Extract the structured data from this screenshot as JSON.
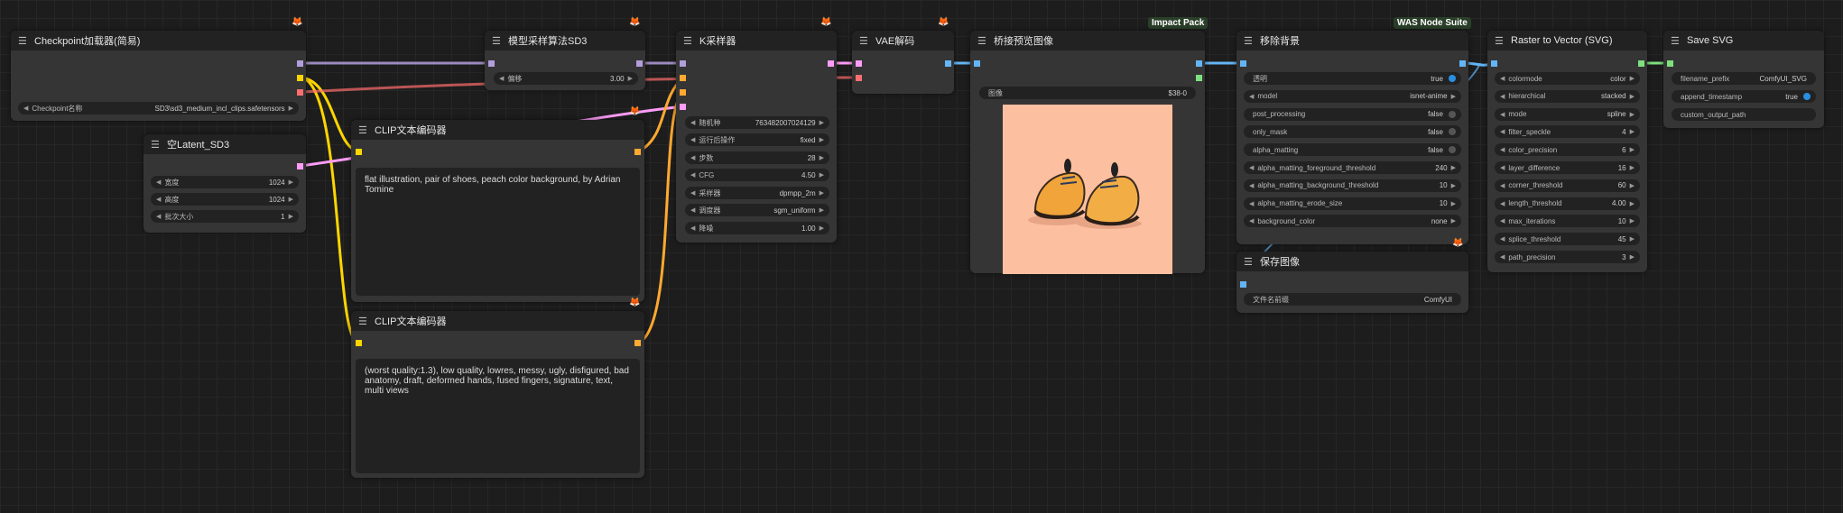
{
  "nodes": {
    "checkpoint": {
      "title": "Checkpoint加载器(简易)",
      "ckpt_label": "Checkpoint名称",
      "ckpt_value": "SD3\\sd3_medium_incl_clips.safetensors"
    },
    "latent": {
      "title": "空Latent_SD3",
      "width_label": "宽度",
      "width_value": "1024",
      "height_label": "高度",
      "height_value": "1024",
      "batch_label": "批次大小",
      "batch_value": "1"
    },
    "sampling": {
      "title": "模型采样算法SD3",
      "shift_label": "偏移",
      "shift_value": "3.00"
    },
    "clip_pos": {
      "title": "CLIP文本编码器",
      "text": "flat illustration, pair of shoes, peach color background, by Adrian Tomine"
    },
    "clip_neg": {
      "title": "CLIP文本编码器",
      "text": "(worst quality:1.3), low quality, lowres, messy,  ugly, disfigured, bad anatomy, draft, deformed hands, fused fingers, signature, text, multi views"
    },
    "ksampler": {
      "title": "K采样器",
      "seed_label": "随机种",
      "seed_value": "763482007024129",
      "control_label": "运行后操作",
      "control_value": "fixed",
      "steps_label": "步数",
      "steps_value": "28",
      "cfg_label": "CFG",
      "cfg_value": "4.50",
      "sampler_label": "采样器",
      "sampler_value": "dpmpp_2m",
      "scheduler_label": "调度器",
      "scheduler_value": "sgm_uniform",
      "denoise_label": "降噪",
      "denoise_value": "1.00"
    },
    "vae": {
      "title": "VAE解码"
    },
    "preview": {
      "title": "桥接预览图像",
      "pack": "Impact Pack",
      "image_label": "图像",
      "image_value": "$38-0"
    },
    "rembg": {
      "title": "移除背景",
      "pack": "WAS Node Suite",
      "rows": [
        {
          "label": "透明",
          "value": "true",
          "toggle": true,
          "on": true
        },
        {
          "label": "model",
          "value": "isnet-anime",
          "toggle": false
        },
        {
          "label": "post_processing",
          "value": "false",
          "toggle": true,
          "on": false
        },
        {
          "label": "only_mask",
          "value": "false",
          "toggle": true,
          "on": false
        },
        {
          "label": "alpha_matting",
          "value": "false",
          "toggle": true,
          "on": false
        },
        {
          "label": "alpha_matting_foreground_threshold",
          "value": "240",
          "toggle": false
        },
        {
          "label": "alpha_matting_background_threshold",
          "value": "10",
          "toggle": false
        },
        {
          "label": "alpha_matting_erode_size",
          "value": "10",
          "toggle": false
        },
        {
          "label": "background_color",
          "value": "none",
          "toggle": false
        }
      ]
    },
    "save_image": {
      "title": "保存图像",
      "prefix_label": "文件名前缀",
      "prefix_value": "ComfyUI"
    },
    "raster": {
      "title": "Raster to Vector (SVG)",
      "rows": [
        {
          "label": "colormode",
          "value": "color"
        },
        {
          "label": "hierarchical",
          "value": "stacked"
        },
        {
          "label": "mode",
          "value": "spline"
        },
        {
          "label": "filter_speckle",
          "value": "4"
        },
        {
          "label": "color_precision",
          "value": "6"
        },
        {
          "label": "layer_difference",
          "value": "16"
        },
        {
          "label": "corner_threshold",
          "value": "60"
        },
        {
          "label": "length_threshold",
          "value": "4.00"
        },
        {
          "label": "max_iterations",
          "value": "10"
        },
        {
          "label": "splice_threshold",
          "value": "45"
        },
        {
          "label": "path_precision",
          "value": "3"
        }
      ]
    },
    "save_svg": {
      "title": "Save SVG",
      "prefix_label": "filename_prefix",
      "prefix_value": "ComfyUI_SVG",
      "append_label": "append_timestamp",
      "append_value": "true",
      "output_label": "custom_output_path"
    }
  },
  "icons": {
    "menu": "hamburger-icon",
    "badge": "fox-icon",
    "arrow_left": "◀",
    "arrow_right": "▶"
  },
  "colors": {
    "model": "#b39ddb",
    "clip": "#ffd500",
    "conditioning": "#ffa931",
    "latent": "#ff9cf9",
    "vae": "#ff6e6e",
    "image": "#64b5f6",
    "svg": "#7ee07e"
  }
}
